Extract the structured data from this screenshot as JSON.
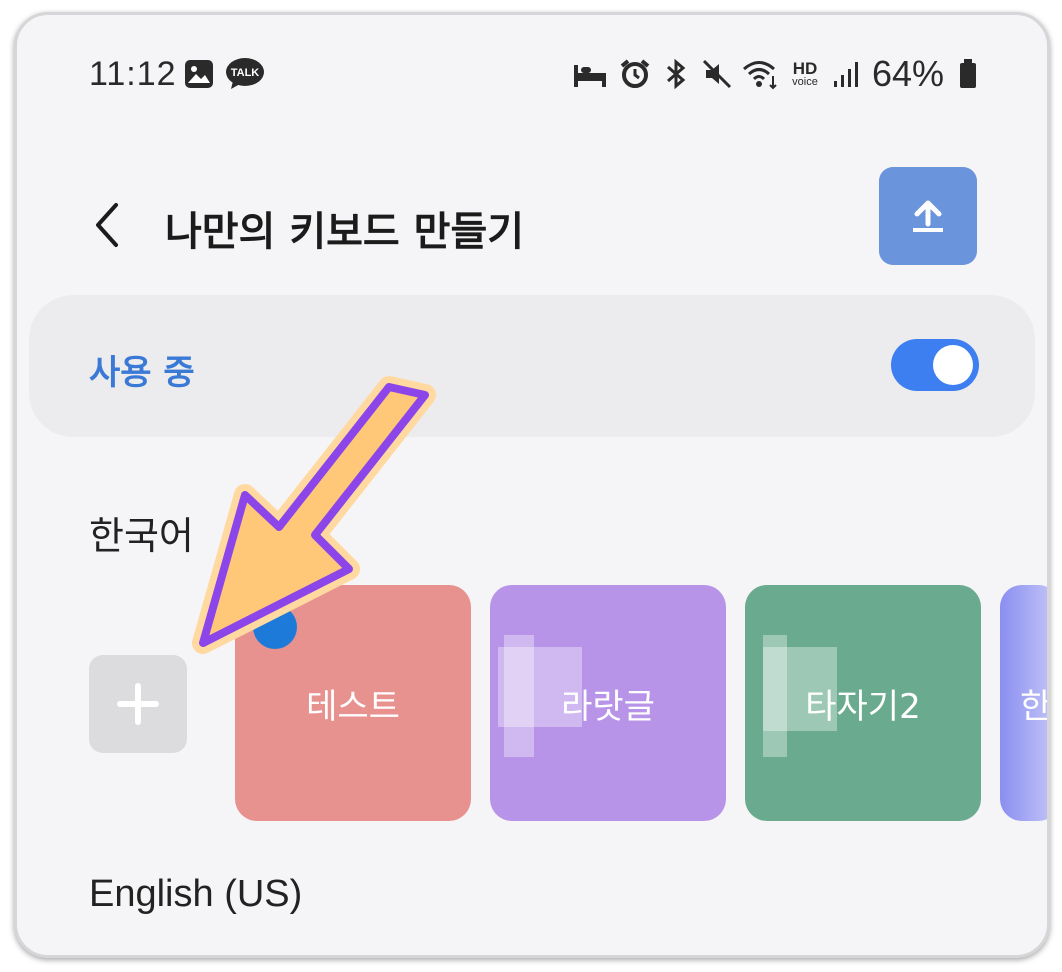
{
  "status_bar": {
    "time": "11:12",
    "left_icons": [
      "gallery-icon",
      "talk-icon"
    ],
    "talk_badge": "TALK",
    "right_icons": [
      "sleep-mode-icon",
      "alarm-icon",
      "bluetooth-icon",
      "mute-icon",
      "wifi-icon",
      "hd-voice-icon",
      "signal-icon",
      "battery-icon"
    ],
    "hd_voice_top": "HD",
    "hd_voice_bottom": "voice",
    "battery_percent": "64%"
  },
  "header": {
    "title": "나만의 키보드 만들기",
    "back_icon": "chevron-left-icon",
    "upload_icon": "upload-icon"
  },
  "in_use": {
    "label": "사용 중",
    "toggle_on": true,
    "accent": "#3d7ff0"
  },
  "sections": {
    "korean": "한국어",
    "english": "English (US)"
  },
  "keyboards": [
    {
      "label": "테스트",
      "color": "#e89290"
    },
    {
      "label": "라랏글",
      "color": "#b794e8"
    },
    {
      "label": "타자기2",
      "color": "#6aab90"
    },
    {
      "label": "한",
      "color": "#8a8ef0"
    }
  ],
  "add_icon": "plus-icon",
  "overlay_arrow_colors": {
    "fill": "#ffc878",
    "stroke": "#8b45e8"
  }
}
